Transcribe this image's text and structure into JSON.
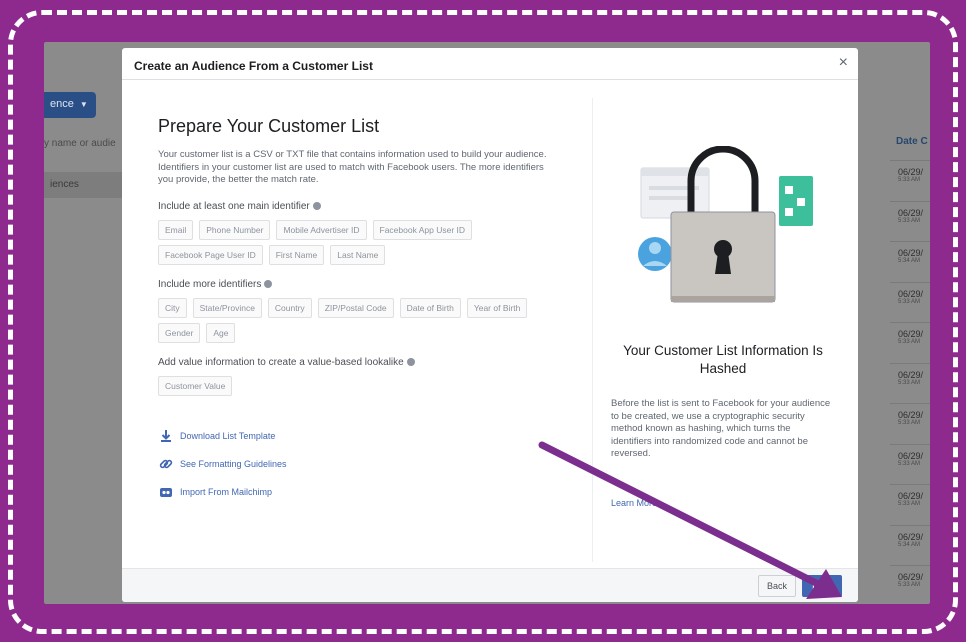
{
  "background_app": {
    "top_text": "",
    "create_button_label": "ence",
    "search_placeholder": "y name or audie",
    "sidebar_item": "iences",
    "column_header": "Date C",
    "rows": [
      {
        "date": "06/29/",
        "time": "5:33 AM"
      },
      {
        "date": "06/29/",
        "time": "5:33 AM"
      },
      {
        "date": "06/29/",
        "time": "5:34 AM"
      },
      {
        "date": "06/29/",
        "time": "5:33 AM"
      },
      {
        "date": "06/29/",
        "time": "5:33 AM"
      },
      {
        "date": "06/29/",
        "time": "5:33 AM"
      },
      {
        "date": "06/29/",
        "time": "5:33 AM"
      },
      {
        "date": "06/29/",
        "time": "5:33 AM"
      },
      {
        "date": "06/29/",
        "time": "5:33 AM"
      },
      {
        "date": "06/29/",
        "time": "5:34 AM"
      },
      {
        "date": "06/29/",
        "time": "5:33 AM"
      }
    ]
  },
  "modal": {
    "title": "Create an Audience From a Customer List",
    "close_symbol": "×",
    "left": {
      "heading": "Prepare Your Customer List",
      "description": "Your customer list is a CSV or TXT file that contains information used to build your audience. Identifiers in your customer list are used to match with Facebook users. The more identifiers you provide, the better the match rate.",
      "main_identifier_label": "Include at least one main identifier",
      "main_identifiers": [
        "Email",
        "Phone Number",
        "Mobile Advertiser ID",
        "Facebook App User ID",
        "Facebook Page User ID",
        "First Name",
        "Last Name"
      ],
      "more_identifier_label": "Include more identifiers",
      "more_identifiers": [
        "City",
        "State/Province",
        "Country",
        "ZIP/Postal Code",
        "Date of Birth",
        "Year of Birth",
        "Gender",
        "Age"
      ],
      "value_label": "Add value information to create a value-based lookalike",
      "value_identifiers": [
        "Customer Value"
      ],
      "links": [
        {
          "icon": "download-icon",
          "label": "Download List Template"
        },
        {
          "icon": "link-icon",
          "label": "See Formatting Guidelines"
        },
        {
          "icon": "mailchimp-icon",
          "label": "Import From Mailchimp"
        }
      ]
    },
    "right": {
      "title": "Your Customer List Information Is Hashed",
      "description": "Before the list is sent to Facebook for your audience to be created, we use a cryptographic security method known as hashing, which turns the identifiers into randomized code and cannot be reversed.",
      "learn_more": "Learn More"
    },
    "footer": {
      "back_label": "Back",
      "next_label": "Next"
    }
  },
  "colors": {
    "frame_background": "#8e2a8e",
    "facebook_blue": "#4267b2",
    "arrow": "#7b2e8e"
  }
}
